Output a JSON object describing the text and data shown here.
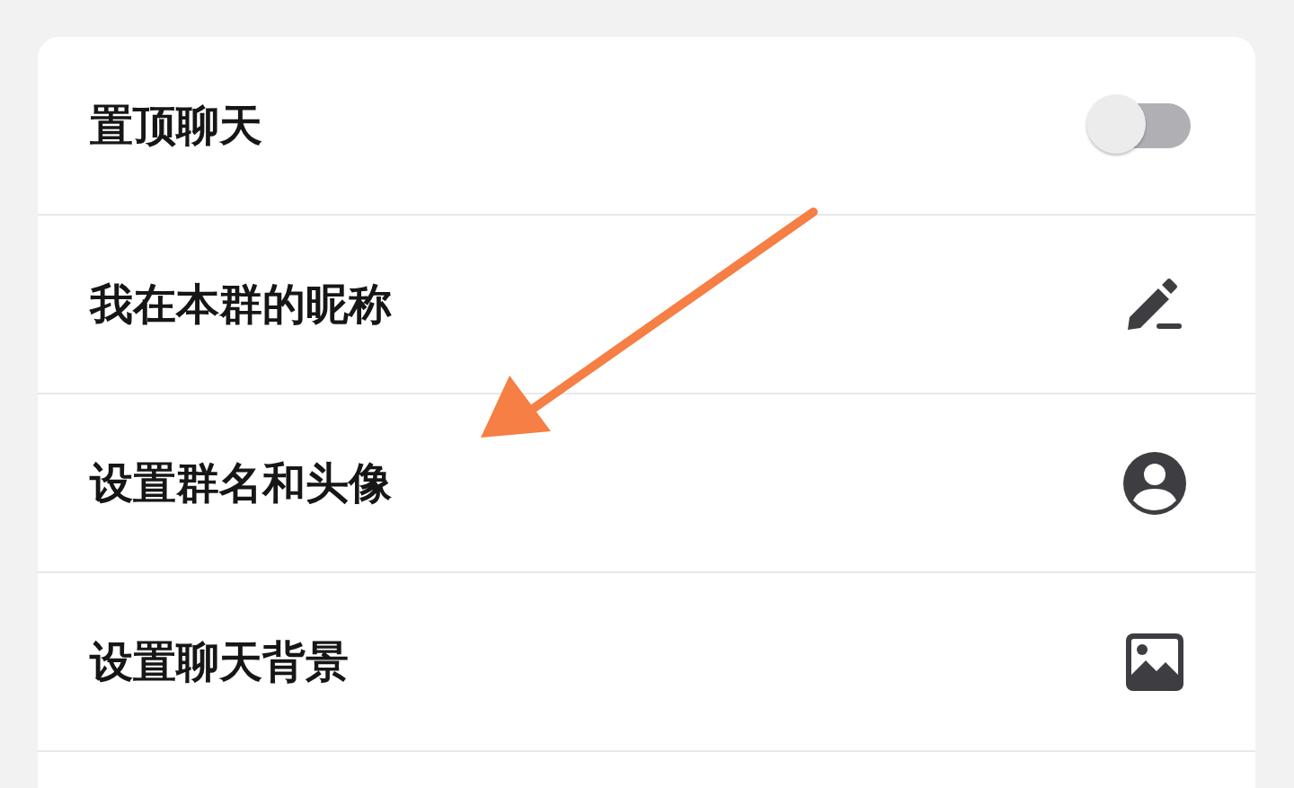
{
  "rows": [
    {
      "label": "置顶聊天",
      "kind": "toggle",
      "on": false
    },
    {
      "label": "我在本群的昵称",
      "kind": "edit"
    },
    {
      "label": "设置群名和头像",
      "kind": "avatar"
    },
    {
      "label": "设置聊天背景",
      "kind": "image"
    }
  ]
}
